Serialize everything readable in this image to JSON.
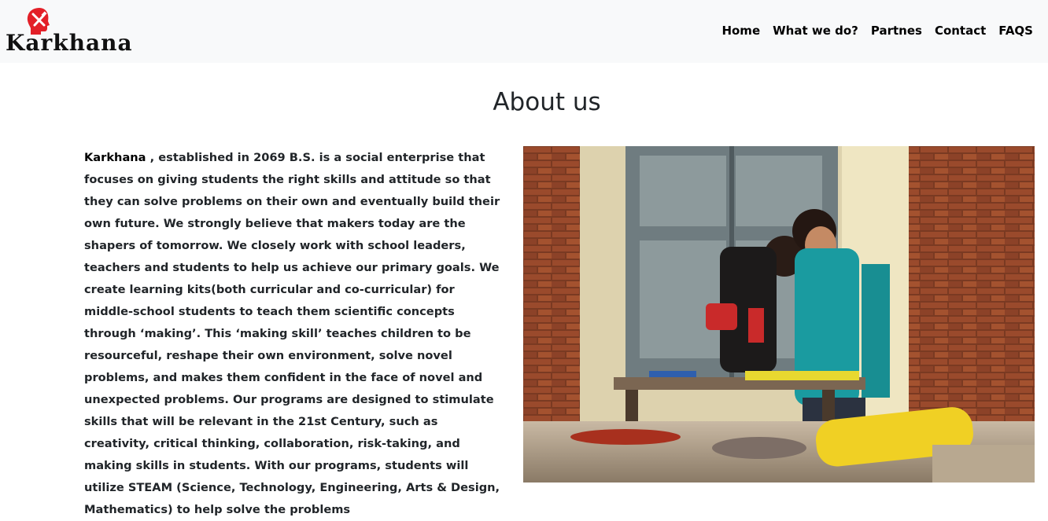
{
  "brand": {
    "name": "Karkhana"
  },
  "nav": {
    "items": [
      "Home",
      "What we do?",
      "Partnes",
      "Contact",
      "FAQS"
    ]
  },
  "about": {
    "title": "About us",
    "lead": "Karkhana",
    "body": " , established in 2069 B.S. is a social enterprise that focuses on giving students the right skills and attitude so that they can solve problems on their own and eventually build their own future. We strongly believe that makers today are the shapers of tomorrow. We closely work with school leaders, teachers and students to help us achieve our primary goals. We create learning kits(both curricular and co-curricular) for middle-school students to teach them scientific concepts through ‘making’. This ‘making skill’ teaches children to be resourceful, reshape their own environment, solve novel problems, and makes them confident in the face of novel and unexpected problems. Our programs are designed to stimulate skills that will be relevant in the 21st Century, such as creativity, critical thinking, collaboration, risk-taking, and making skills in students. With our programs, students will utilize STEAM (Science, Technology, Engineering, Arts & Design, Mathematics) to help solve the problems"
  },
  "colors": {
    "navbar_bg": "#f8f9fa",
    "logo_red": "#e32028",
    "text": "#212529"
  },
  "icons": {
    "logo": "head-with-tools-icon"
  }
}
